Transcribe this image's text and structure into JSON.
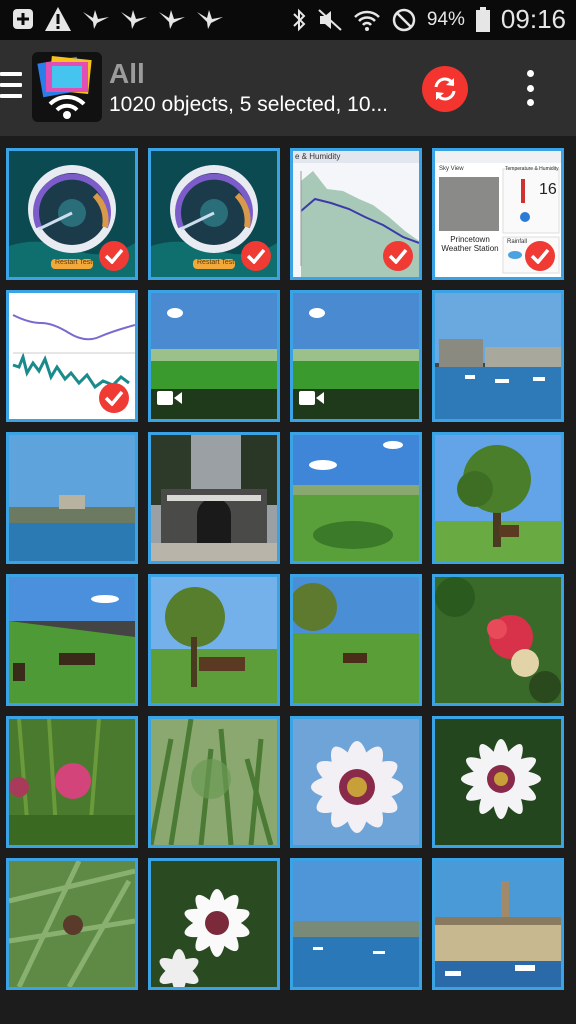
{
  "status_bar": {
    "icons_left": [
      "add-icon",
      "warning-icon",
      "bird-icon",
      "bird-icon",
      "bird-icon",
      "bird-icon"
    ],
    "icons_right": [
      "bluetooth-icon",
      "mute-icon",
      "wifi-icon",
      "blocked-icon"
    ],
    "battery": "94%",
    "time": "09:16"
  },
  "app_bar": {
    "title": "All",
    "subtitle": "1020 objects, 5 selected, 10..."
  },
  "colors": {
    "accent": "#3aa3e6",
    "check": "#f03a34",
    "refresh": "#f4342e"
  },
  "tiles": [
    {
      "kind": "speedtest",
      "selected": true,
      "button": "Restart Test"
    },
    {
      "kind": "speedtest",
      "selected": true,
      "button": "Restart Test"
    },
    {
      "kind": "graph",
      "selected": true,
      "header": "e & Humidity"
    },
    {
      "kind": "weather",
      "selected": true,
      "sky": "Sky View",
      "temp": "Temperature & Humidity",
      "station": "Princetown Weather Station",
      "rain": "Rainfall",
      "value": "16"
    },
    {
      "kind": "graph2",
      "selected": true
    },
    {
      "kind": "landscape",
      "video": true
    },
    {
      "kind": "landscape",
      "video": true
    },
    {
      "kind": "harbour"
    },
    {
      "kind": "harbour2"
    },
    {
      "kind": "gate"
    },
    {
      "kind": "moor"
    },
    {
      "kind": "tree"
    },
    {
      "kind": "moor-ponies"
    },
    {
      "kind": "tree-ponies"
    },
    {
      "kind": "tree-ponies2"
    },
    {
      "kind": "red-flower"
    },
    {
      "kind": "pink-flower"
    },
    {
      "kind": "grass"
    },
    {
      "kind": "daisy"
    },
    {
      "kind": "daisy2"
    },
    {
      "kind": "thistle"
    },
    {
      "kind": "daisies"
    },
    {
      "kind": "harbour3"
    },
    {
      "kind": "dockyard"
    }
  ]
}
